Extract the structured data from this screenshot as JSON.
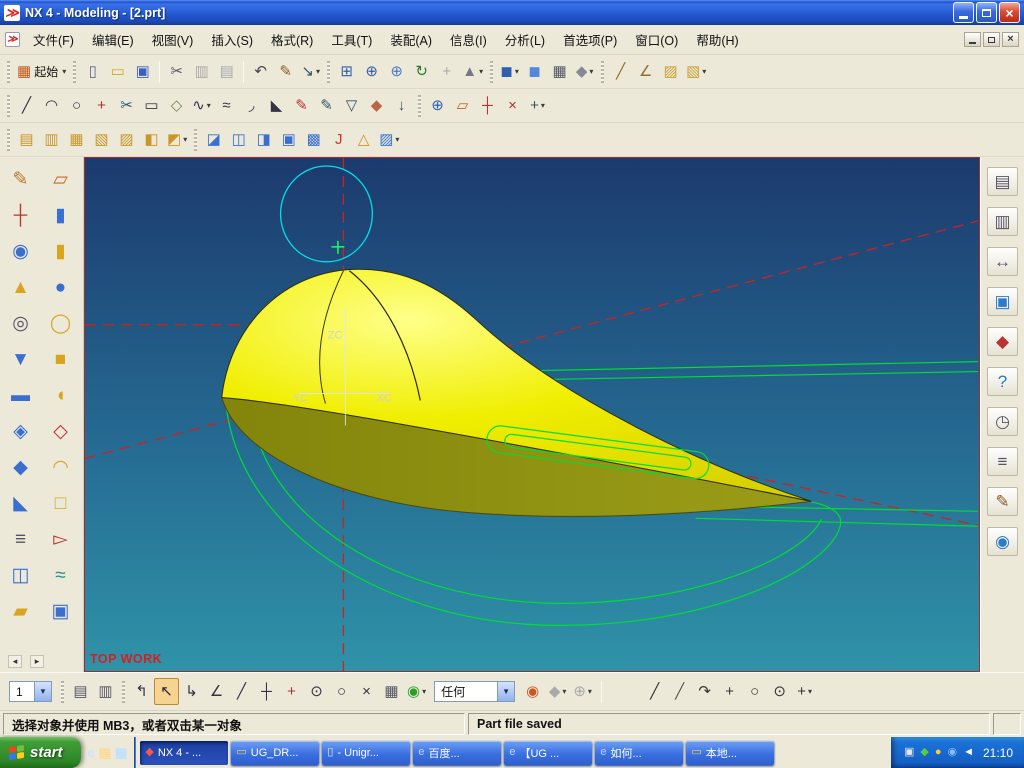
{
  "window": {
    "title": "NX 4 - Modeling - [2.prt]"
  },
  "ui": {
    "dropdown_glyph": "▾",
    "combo_arrow_glyph": "▼",
    "close_glyph": "×",
    "scroll_left_glyph": "◂",
    "scroll_right_glyph": "▸"
  },
  "menu_bar": {
    "items": [
      {
        "n": "menu-file",
        "label": "文件(F)"
      },
      {
        "n": "menu-edit",
        "label": "编辑(E)"
      },
      {
        "n": "menu-view",
        "label": "视图(V)"
      },
      {
        "n": "menu-insert",
        "label": "插入(S)"
      },
      {
        "n": "menu-format",
        "label": "格式(R)"
      },
      {
        "n": "menu-tools",
        "label": "工具(T)"
      },
      {
        "n": "menu-assemblies",
        "label": "装配(A)"
      },
      {
        "n": "menu-information",
        "label": "信息(I)"
      },
      {
        "n": "menu-analysis",
        "label": "分析(L)"
      },
      {
        "n": "menu-preferences",
        "label": "首选项(P)"
      },
      {
        "n": "menu-window",
        "label": "窗口(O)"
      },
      {
        "n": "menu-help",
        "label": "帮助(H)"
      }
    ]
  },
  "toolbars": {
    "row1": [
      {
        "grab": true
      },
      {
        "n": "start-app-button",
        "label": "起始",
        "g": "▦",
        "c": "#c2571a",
        "dd": true
      },
      {
        "grab": true
      },
      {
        "n": "new-file-button",
        "g": "▯",
        "c": "#566a8f"
      },
      {
        "n": "open-file-button",
        "g": "▭",
        "c": "#d9a520"
      },
      {
        "n": "save-button",
        "g": "▣",
        "c": "#3a5fc0"
      },
      {
        "sep": true
      },
      {
        "n": "cut-button",
        "g": "✂",
        "c": "#556"
      },
      {
        "n": "copy-button",
        "g": "▥",
        "c": "#99a",
        "grey": true
      },
      {
        "n": "paste-button",
        "g": "▤",
        "c": "#99a",
        "grey": true
      },
      {
        "sep": true
      },
      {
        "n": "undo-button",
        "g": "↶",
        "c": "#445"
      },
      {
        "n": "redlining-button",
        "g": "✎",
        "c": "#8a5a2a"
      },
      {
        "n": "export-image-button",
        "g": "↘",
        "c": "#356",
        "dd": true
      },
      {
        "grab": true
      },
      {
        "n": "fit-view-button",
        "g": "⊞",
        "c": "#2f5fae"
      },
      {
        "n": "zoom-button",
        "g": "⊕",
        "c": "#2f5fae"
      },
      {
        "n": "zoom-in-button",
        "g": "⊕",
        "c": "#4a7ace"
      },
      {
        "n": "rotate-view-button",
        "g": "↻",
        "c": "#2a7a2a"
      },
      {
        "n": "pan-button",
        "g": "+",
        "c": "#99a",
        "grey": true
      },
      {
        "n": "perspective-button",
        "g": "▲",
        "c": "#778",
        "dd": true
      },
      {
        "grab": true
      },
      {
        "n": "shaded-view-button",
        "g": "◼",
        "c": "#2f5fae",
        "dd": true
      },
      {
        "n": "shaded-edges-button",
        "g": "◼",
        "c": "#5588dd"
      },
      {
        "n": "wireframe-view-button",
        "g": "▦",
        "c": "#556"
      },
      {
        "n": "rendering-style-button",
        "g": "◆",
        "c": "#889",
        "dd": true
      },
      {
        "grab": true
      },
      {
        "n": "measure-distance-button",
        "g": "╱",
        "c": "#946c2f"
      },
      {
        "n": "measure-angle-button",
        "g": "∠",
        "c": "#946c2f"
      },
      {
        "n": "surface-analysis-button",
        "g": "▨",
        "c": "#caa032"
      },
      {
        "n": "more-analysis-button",
        "g": "▧",
        "c": "#caa032",
        "dd": true
      }
    ],
    "row2": [
      {
        "grab": true
      },
      {
        "n": "line-button",
        "g": "╱",
        "c": "#334"
      },
      {
        "n": "arc-button",
        "g": "◠",
        "c": "#334"
      },
      {
        "n": "circle-button",
        "g": "○",
        "c": "#334"
      },
      {
        "n": "point-button",
        "g": "+",
        "c": "#a33"
      },
      {
        "n": "quick-trim-button",
        "g": "✂",
        "c": "#356"
      },
      {
        "n": "rectangle-button",
        "g": "▭",
        "c": "#334"
      },
      {
        "n": "profile-button",
        "g": "◇",
        "c": "#785"
      },
      {
        "n": "spline-button",
        "g": "∿",
        "c": "#334",
        "dd": true
      },
      {
        "n": "offset-curve-button",
        "g": "≈",
        "c": "#334"
      },
      {
        "n": "fillet-button",
        "g": "◞",
        "c": "#334"
      },
      {
        "n": "chamfer-button",
        "g": "◣",
        "c": "#334"
      },
      {
        "n": "edit-curve-button",
        "g": "✎",
        "c": "#b33"
      },
      {
        "n": "divide-curve-button",
        "g": "✎",
        "c": "#356"
      },
      {
        "n": "project-curve-button",
        "g": "▽",
        "c": "#356"
      },
      {
        "n": "fill-button",
        "g": "◆",
        "c": "#b64"
      },
      {
        "n": "arrow-button",
        "g": "↓",
        "c": "#356"
      },
      {
        "grab": true
      },
      {
        "n": "zoom-curve-button",
        "g": "⊕",
        "c": "#2f5fae"
      },
      {
        "n": "datum-plane-button",
        "g": "▱",
        "c": "#c0622a"
      },
      {
        "n": "datum-axis-button",
        "g": "┼",
        "c": "#b33"
      },
      {
        "n": "unsew-button",
        "g": "×",
        "c": "#a33"
      },
      {
        "n": "insert-sketch-button",
        "g": "+",
        "c": "#356",
        "dd": true
      }
    ],
    "row3": [
      {
        "grab": true
      },
      {
        "n": "ruled-surface-button",
        "g": "▤",
        "c": "#c9962a"
      },
      {
        "n": "through-curves-button",
        "g": "▥",
        "c": "#c9962a"
      },
      {
        "n": "through-curve-mesh-button",
        "g": "▦",
        "c": "#c9962a"
      },
      {
        "n": "swept-surface-button",
        "g": "▧",
        "c": "#c9962a"
      },
      {
        "n": "section-surface-button",
        "g": "▨",
        "c": "#c9962a"
      },
      {
        "n": "bridge-surface-button",
        "g": "◧",
        "c": "#c9962a"
      },
      {
        "n": "n-sided-surface-button",
        "g": "◩",
        "c": "#c9962a",
        "dd": true
      },
      {
        "grab": true
      },
      {
        "n": "studio-surface-button",
        "g": "◪",
        "c": "#3a6fd0"
      },
      {
        "n": "styled-blend-button",
        "g": "◫",
        "c": "#3a6fd0"
      },
      {
        "n": "face-blend-button",
        "g": "◨",
        "c": "#3a6fd0"
      },
      {
        "n": "offset-surface-button",
        "g": "▣",
        "c": "#3a6fd0"
      },
      {
        "n": "trimmed-sheet-button",
        "g": "▩",
        "c": "#3a6fd0"
      },
      {
        "n": "extension-button",
        "g": "J",
        "c": "#c33"
      },
      {
        "n": "law-extension-button",
        "g": "△",
        "c": "#c9962a"
      },
      {
        "n": "more-surface-button",
        "g": "▨",
        "c": "#3a6fd0",
        "dd": true
      }
    ]
  },
  "left_toolbar": {
    "icons": [
      {
        "n": "sketch-button",
        "g": "✎",
        "c": "#b8762a"
      },
      {
        "n": "datum-plane-feature-button",
        "g": "▱",
        "c": "#c66a2a"
      },
      {
        "n": "datum-csys-button",
        "g": "┼",
        "c": "#b33"
      },
      {
        "n": "extrude-button",
        "g": "▮",
        "c": "#3a6fd0"
      },
      {
        "n": "revolve-button",
        "g": "◉",
        "c": "#3a6fd0"
      },
      {
        "n": "cylinder-button",
        "g": "▮",
        "c": "#d9a520"
      },
      {
        "n": "cone-button",
        "g": "▲",
        "c": "#d9a520"
      },
      {
        "n": "sphere-button",
        "g": "●",
        "c": "#3a6fd0"
      },
      {
        "n": "hole-button",
        "g": "◎",
        "c": "#556"
      },
      {
        "n": "boss-button",
        "g": "◯",
        "c": "#d9a520"
      },
      {
        "n": "pocket-button",
        "g": "▼",
        "c": "#3a6fd0"
      },
      {
        "n": "pad-button",
        "g": "■",
        "c": "#d9a520"
      },
      {
        "n": "slot-button",
        "g": "▬",
        "c": "#3a6fd0"
      },
      {
        "n": "groove-button",
        "g": "◖",
        "c": "#d9a520"
      },
      {
        "n": "unite-button",
        "g": "◈",
        "c": "#3a6fd0"
      },
      {
        "n": "subtract-button",
        "g": "◇",
        "c": "#b33"
      },
      {
        "n": "intersect-button",
        "g": "◆",
        "c": "#3a6fd0"
      },
      {
        "n": "edge-blend-button",
        "g": "◠",
        "c": "#d9a520"
      },
      {
        "n": "chamfer-feature-button",
        "g": "◣",
        "c": "#3a6fd0"
      },
      {
        "n": "shell-button",
        "g": "□",
        "c": "#d9a520"
      },
      {
        "n": "thread-button",
        "g": "≡",
        "c": "#556"
      },
      {
        "n": "trim-body-button",
        "g": "▻",
        "c": "#b33"
      },
      {
        "n": "split-body-button",
        "g": "◫",
        "c": "#3a6fd0"
      },
      {
        "n": "sew-button",
        "g": "≈",
        "c": "#2a8a8a"
      },
      {
        "n": "offset-face-button",
        "g": "▰",
        "c": "#d9a520"
      },
      {
        "n": "instance-feature-button",
        "g": "▣",
        "c": "#3a6fd0"
      }
    ]
  },
  "right_toolbar": {
    "icons": [
      {
        "n": "tile-layout-button",
        "g": "▤",
        "c": "#556"
      },
      {
        "n": "cascade-layout-button",
        "g": "▥",
        "c": "#556"
      },
      {
        "n": "dimension-style-button",
        "g": "↔",
        "c": "#556"
      },
      {
        "n": "display-mode-button",
        "g": "▣",
        "c": "#2a7ad0"
      },
      {
        "n": "e-learning-button",
        "g": "◆",
        "c": "#b33"
      },
      {
        "n": "help-button",
        "g": "?",
        "c": "#2a7ad0"
      },
      {
        "n": "history-clock-button",
        "g": "◷",
        "c": "#556"
      },
      {
        "n": "information-window-button",
        "g": "≡",
        "c": "#556"
      },
      {
        "n": "notes-button",
        "g": "✎",
        "c": "#8a5a2a"
      },
      {
        "n": "roles-button",
        "g": "◉",
        "c": "#2a7ad0"
      }
    ]
  },
  "viewport": {
    "labels": {
      "zc": "ZC",
      "yc": "YC",
      "xc": "XC"
    },
    "view_label": "TOP WORK",
    "colors": {
      "viewport_bg_top": "#1c3a6e",
      "viewport_bg_mid": "#256a92",
      "viewport_bg_bottom": "#2f93a8",
      "model_highlight": "#ffff8a",
      "model_yellow": "#f0ee00",
      "model_yellow_edge": "#d6d000",
      "model_underside": "#83850c",
      "model_underside_light": "#9b9d18",
      "wireframe_green": "#00dd33",
      "sketch_cyan": "#00e0e6",
      "datum_red": "#cc2222",
      "axis_label_grey": "#ccd2d6",
      "view_label_red": "#d42020"
    }
  },
  "bottom_bar": {
    "layer_value": "1",
    "filter_value": "任何",
    "left_icons": [
      {
        "grab": true
      },
      {
        "n": "layer-settings-button",
        "g": "▤",
        "c": "#556"
      },
      {
        "n": "layer-visible-button",
        "g": "▥",
        "c": "#556"
      },
      {
        "grab": true
      },
      {
        "n": "previous-selection-button",
        "g": "↰",
        "c": "#334"
      },
      {
        "n": "select-arrow-button",
        "g": "↖",
        "c": "#223",
        "active": true
      },
      {
        "n": "next-selection-button",
        "g": "↳",
        "c": "#334"
      },
      {
        "n": "snap-angle-button",
        "g": "∠",
        "c": "#334"
      },
      {
        "n": "snap-end-button",
        "g": "╱",
        "c": "#334"
      },
      {
        "n": "snap-mid-button",
        "g": "┼",
        "c": "#334"
      },
      {
        "n": "snap-point-button",
        "g": "+",
        "c": "#a33"
      },
      {
        "n": "snap-center-button",
        "g": "⊙",
        "c": "#334"
      },
      {
        "n": "snap-quadrant-button",
        "g": "○",
        "c": "#334"
      },
      {
        "n": "snap-intersection-button",
        "g": "×",
        "c": "#334"
      },
      {
        "n": "snap-grid-button",
        "g": "▦",
        "c": "#556"
      },
      {
        "n": "selection-scope-button",
        "g": "◉",
        "c": "#2a9d2a",
        "dd": true
      }
    ],
    "mid_icons": [
      {
        "n": "color-palette-button",
        "g": "◉",
        "c": "#cc5522"
      },
      {
        "n": "highlight-button",
        "g": "◆",
        "c": "#99a",
        "grey": true,
        "dd": true
      },
      {
        "n": "magnify-cursor-button",
        "g": "⊕",
        "c": "#99a",
        "grey": true,
        "dd": true
      }
    ],
    "tail_icons": [
      {
        "n": "snap-line-button",
        "g": "╱",
        "c": "#333"
      },
      {
        "n": "snap-line2-button",
        "g": "╱",
        "c": "#555"
      },
      {
        "n": "snap-arc-button",
        "g": "↷",
        "c": "#333"
      },
      {
        "n": "snap-plus-button",
        "g": "+",
        "c": "#333"
      },
      {
        "n": "snap-circle-button",
        "g": "○",
        "c": "#333"
      },
      {
        "n": "snap-circle-center-button",
        "g": "⊙",
        "c": "#333"
      },
      {
        "n": "snap-more-button",
        "g": "+",
        "c": "#333",
        "dd": true
      }
    ]
  },
  "status_bar": {
    "message": "选择对象并使用 MB3，或者双击某一对象",
    "info": "Part file saved"
  },
  "taskbar": {
    "start_label": "start",
    "flag_colors": [
      "#ee4422",
      "#77bb44",
      "#3377ee",
      "#ffcc22"
    ],
    "quick_launch": [
      {
        "n": "ie-quicklaunch-button",
        "g": "e",
        "c": "#cfe4ff"
      },
      {
        "n": "mail-quicklaunch-button",
        "g": "▤",
        "c": "#ffd890"
      },
      {
        "n": "show-desktop-button",
        "g": "▦",
        "c": "#bfe0ff"
      }
    ],
    "tasks": [
      {
        "n": "task-nx4",
        "label": "NX 4 - ...",
        "g": "◆",
        "c": "#ff5544",
        "active": true
      },
      {
        "n": "task-ug-dr-folder",
        "label": "UG_DR...",
        "g": "▭",
        "c": "#ffd24a"
      },
      {
        "n": "task-unigraphics",
        "label": "- Unigr...",
        "g": "▯",
        "c": "#dfe8ff"
      },
      {
        "n": "task-baidu",
        "label": "百度...",
        "g": "e",
        "c": "#bcd6ff"
      },
      {
        "n": "task-ug-page",
        "label": "【UG ...",
        "g": "e",
        "c": "#bcd6ff"
      },
      {
        "n": "task-how-to",
        "label": "如何...",
        "g": "e",
        "c": "#bcd6ff"
      },
      {
        "n": "task-local-folder",
        "label": "本地...",
        "g": "▭",
        "c": "#ffd24a"
      }
    ],
    "tray_icons": [
      {
        "n": "update-tray-icon",
        "g": "▣",
        "c": "#e8e8e8"
      },
      {
        "n": "antivirus-tray-icon",
        "g": "◆",
        "c": "#55cc44"
      },
      {
        "n": "input-method-tray-icon",
        "g": "●",
        "c": "#ffcc33"
      },
      {
        "n": "download-tray-icon",
        "g": "◉",
        "c": "#88bbff"
      },
      {
        "n": "volume-tray-icon",
        "g": "◄",
        "c": "#ffffff"
      }
    ],
    "clock": "21:10"
  }
}
